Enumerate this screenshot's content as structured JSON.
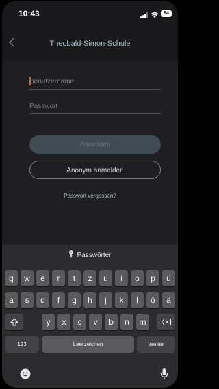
{
  "status": {
    "time": "10:43",
    "battery": "94"
  },
  "nav": {
    "title": "Theobald-Simon-Schule"
  },
  "form": {
    "username_placeholder": "Benutzername",
    "password_placeholder": "Passwort",
    "login_label": "Anmelden",
    "anon_label": "Anonym anmelden",
    "forgot_label": "Passwort vergessen?"
  },
  "keyboard": {
    "suggestion": "Passwörter",
    "row1": [
      "q",
      "w",
      "e",
      "r",
      "t",
      "z",
      "u",
      "i",
      "o",
      "p",
      "ü"
    ],
    "row2": [
      "a",
      "s",
      "d",
      "f",
      "g",
      "h",
      "j",
      "k",
      "l",
      "ö",
      "ä"
    ],
    "row3": [
      "y",
      "x",
      "c",
      "v",
      "b",
      "n",
      "m"
    ],
    "numbers_label": "123",
    "space_label": "Leerzeichen",
    "return_label": "Weiter"
  },
  "colors": {
    "accent": "#a6c0c9",
    "caret": "#d36a2a",
    "background": "#1f1f21"
  }
}
